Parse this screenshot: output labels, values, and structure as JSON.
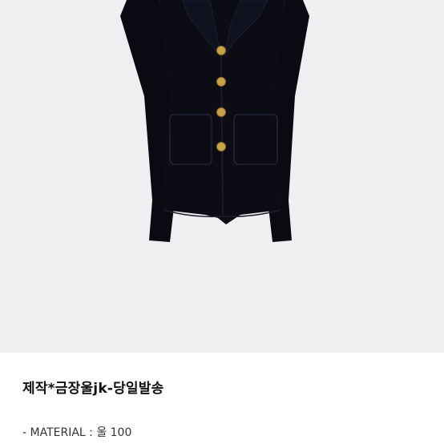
{
  "product": {
    "title": "제작*금장울jk-당일발송",
    "material_line": "- MATERIAL : 울 100"
  },
  "colors": {
    "image_background": "#efeff1",
    "jacket": "#0b0c14",
    "buttons": "#c9a24a"
  },
  "image": {
    "subject": "black-tweed-jacket-with-gold-buttons"
  }
}
